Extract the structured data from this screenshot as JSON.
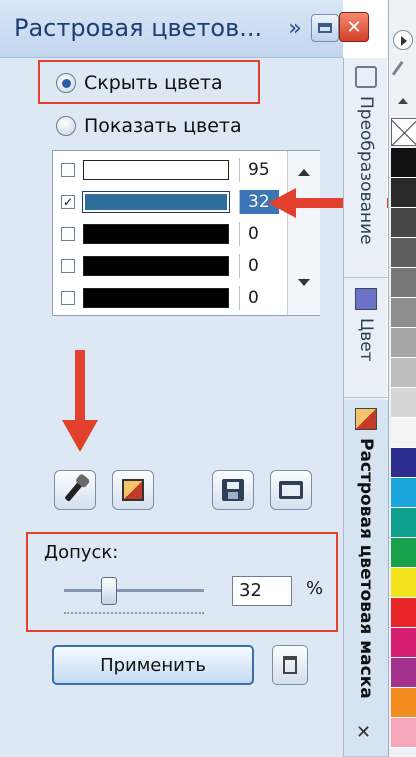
{
  "docker": {
    "title": "Растровая цветов...",
    "expand_glyph": "»",
    "close_glyph": "✕"
  },
  "mode": {
    "hide_label": "Скрыть цвета",
    "show_label": "Показать цвета",
    "selected": "hide"
  },
  "color_list": {
    "rows": [
      {
        "checked": false,
        "color": "#ffffff",
        "value": "95",
        "selected": false
      },
      {
        "checked": true,
        "color": "#2f6e9a",
        "value": "32",
        "selected": true
      },
      {
        "checked": false,
        "color": "#000000",
        "value": "0",
        "selected": false
      },
      {
        "checked": false,
        "color": "#000000",
        "value": "0",
        "selected": false
      },
      {
        "checked": false,
        "color": "#000000",
        "value": "0",
        "selected": false
      }
    ],
    "check_glyph": "✓"
  },
  "tolerance": {
    "label": "Допуск:",
    "value": "32",
    "unit": "%",
    "slider_level_percent": 32
  },
  "apply_label": "Применить",
  "tabs": {
    "transform": "Преобразование",
    "color": "Цвет",
    "bitmap_mask": "Растровая цветовая маска",
    "close_glyph": "✕"
  },
  "palette": {
    "colors": [
      "#111111",
      "#2a2a2a",
      "#474747",
      "#5e5e5e",
      "#777777",
      "#8e8e8e",
      "#a6a6a6",
      "#bebebe",
      "#d6d6d6",
      "#f4f4f4",
      "#2b2d8f",
      "#1aa4dc",
      "#0fa08f",
      "#19a04a",
      "#f2e31a",
      "#e8262a",
      "#d61f73",
      "#a5318e",
      "#f28c1e",
      "#f6a6b8"
    ]
  },
  "icons": {
    "eyedropper": "eyedropper-icon",
    "color_mask": "color-mask-icon",
    "save": "save-icon",
    "open": "folder-open-icon",
    "trash": "trash-icon"
  },
  "annotation_color": "#e3412e"
}
